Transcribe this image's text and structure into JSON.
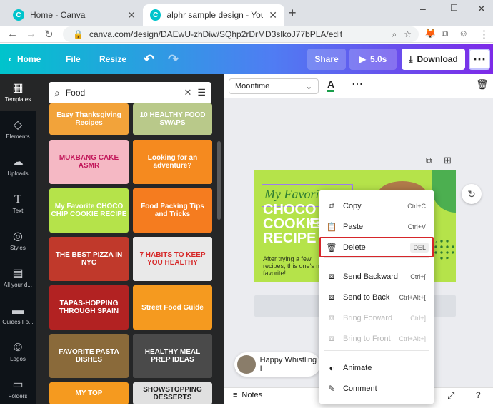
{
  "browser": {
    "tabs": [
      {
        "title": "Home - Canva"
      },
      {
        "title": "alphr sample design - YouTube T"
      }
    ],
    "url": "canva.com/design/DAEwU-zhDiw/SQhp2rDrMD3slkoJ77bPLA/edit"
  },
  "header": {
    "home": "Home",
    "file": "File",
    "resize": "Resize",
    "share": "Share",
    "play": "5.0s",
    "download": "Download"
  },
  "rail": [
    {
      "label": "Templates",
      "icon": "templates-icon"
    },
    {
      "label": "Elements",
      "icon": "elements-icon"
    },
    {
      "label": "Uploads",
      "icon": "uploads-icon"
    },
    {
      "label": "Text",
      "icon": "text-icon"
    },
    {
      "label": "Styles",
      "icon": "styles-icon"
    },
    {
      "label": "All your d...",
      "icon": "all-designs-icon"
    },
    {
      "label": "Guides Fo...",
      "icon": "guides-icon"
    },
    {
      "label": "Logos",
      "icon": "logos-icon"
    },
    {
      "label": "Folders",
      "icon": "folders-icon"
    }
  ],
  "search": {
    "value": "Food"
  },
  "thumbnails": [
    {
      "text": "Easy Thanksgiving Recipes",
      "bg": "#f2a33a",
      "fg": "#fff"
    },
    {
      "text": "10 HEALTHY FOOD SWAPS",
      "bg": "#b9c98a",
      "fg": "#fff"
    },
    {
      "text": "MUKBANG CAKE ASMR",
      "bg": "#f5b8c4",
      "fg": "#c2185b"
    },
    {
      "text": "Looking for an adventure?",
      "bg": "#f58a1f",
      "fg": "#fff"
    },
    {
      "text": "My Favorite CHOCO CHIP COOKIE RECIPE",
      "bg": "#b5e34a",
      "fg": "#fff"
    },
    {
      "text": "Food Packing Tips and Tricks",
      "bg": "#f57c1f",
      "fg": "#fff"
    },
    {
      "text": "THE BEST PIZZA IN NYC",
      "bg": "#c0392b",
      "fg": "#fff"
    },
    {
      "text": "7 HABITS TO KEEP YOU HEALTHY",
      "bg": "#e9e9e9",
      "fg": "#d62828"
    },
    {
      "text": "TAPAS-HOPPING THROUGH SPAIN",
      "bg": "#b22222",
      "fg": "#fff"
    },
    {
      "text": "Street Food Guide",
      "bg": "#f59a1f",
      "fg": "#fff"
    },
    {
      "text": "FAVORITE PASTA DISHES",
      "bg": "#8a6a3a",
      "fg": "#fff"
    },
    {
      "text": "HEALTHY MEAL PREP IDEAS",
      "bg": "#4a4a4a",
      "fg": "#fff"
    },
    {
      "text": "MY TOP",
      "bg": "#f59a1f",
      "fg": "#fff"
    },
    {
      "text": "SHOWSTOPPING DESSERTS",
      "bg": "#e0e0e0",
      "fg": "#222"
    }
  ],
  "toolbar": {
    "font": "Moontime"
  },
  "canvas": {
    "script": "My Favorite",
    "title": "CHOCO COOKIE RECIPE",
    "body": "After trying a few recipes, this one's my favorite!"
  },
  "menu": [
    {
      "label": "Copy",
      "shortcut": "Ctrl+C",
      "icon": "copy-icon",
      "disabled": false
    },
    {
      "label": "Paste",
      "shortcut": "Ctrl+V",
      "icon": "paste-icon",
      "disabled": false
    },
    {
      "label": "Delete",
      "shortcut": "DEL",
      "icon": "trash-icon",
      "disabled": false
    },
    {
      "label": "Send Backward",
      "shortcut": "Ctrl+[",
      "icon": "send-backward-icon",
      "disabled": false
    },
    {
      "label": "Send to Back",
      "shortcut": "Ctrl+Alt+[",
      "icon": "send-to-back-icon",
      "disabled": false
    },
    {
      "label": "Bring Forward",
      "shortcut": "Ctrl+]",
      "icon": "bring-forward-icon",
      "disabled": true
    },
    {
      "label": "Bring to Front",
      "shortcut": "Ctrl+Alt+]",
      "icon": "bring-to-front-icon",
      "disabled": true
    },
    {
      "label": "Animate",
      "shortcut": "",
      "icon": "animate-icon",
      "disabled": false
    },
    {
      "label": "Comment",
      "shortcut": "",
      "icon": "comment-icon",
      "disabled": false
    }
  ],
  "chat": {
    "text": "Happy Whistling I"
  },
  "bottombar": {
    "notes": "Notes"
  },
  "colors": {
    "accent": "#7d2ae8",
    "highlight": "#d6262a",
    "canvas": "#b5e34a"
  }
}
